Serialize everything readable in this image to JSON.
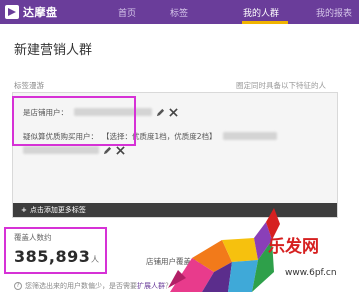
{
  "brand": {
    "name": "达摩盘"
  },
  "nav": {
    "items": [
      {
        "label": "首页",
        "active": false
      },
      {
        "label": "标签",
        "active": false
      },
      {
        "label": "我的人群",
        "active": true
      },
      {
        "label": "我的报表",
        "active": false
      }
    ]
  },
  "page": {
    "title": "新建营销人群"
  },
  "tags": {
    "label": "标签漫游",
    "hint": "圈定同时具备以下特征的人",
    "rules": [
      {
        "name": "是店铺用户："
      },
      {
        "name": "疑似算优质购买用户：",
        "selection": "【选择：优质度1档，优质度2档】"
      }
    ],
    "add_button": "点击添加更多标签"
  },
  "audience": {
    "label": "覆盖人数约",
    "count": "385,893",
    "unit": "人",
    "side_text": "店铺用户覆盖人数"
  },
  "footer": {
    "note": "您筛选出来的用户数偏少，是否需要",
    "link": "扩展人群",
    "suffix": "？"
  },
  "watermark": {
    "text": "乐发网",
    "url": "www.6pf.cn"
  },
  "colors": {
    "nav_bg": "#6a3d9a",
    "nav_active_underline": "#f0b400",
    "highlight_border": "#d631d6",
    "add_bar_bg": "#3d3d3d"
  }
}
